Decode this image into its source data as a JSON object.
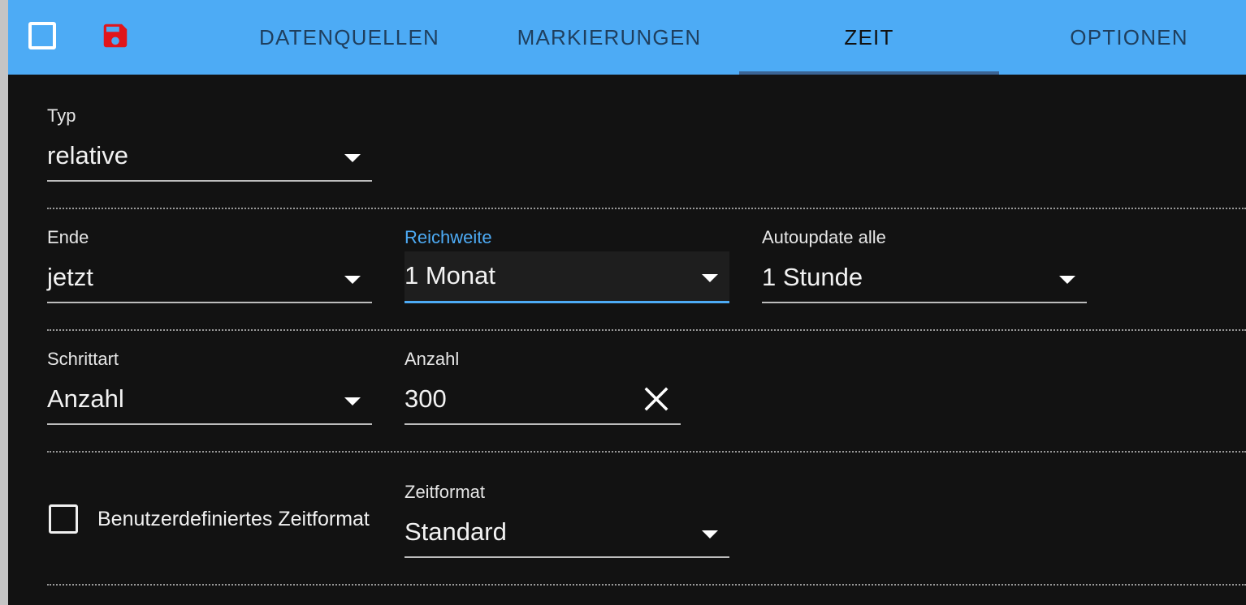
{
  "toolbar": {
    "toggle_icon": "square-outline-icon",
    "save_icon": "floppy-disk-icon",
    "save_color": "#e0161c"
  },
  "tabs": [
    {
      "label": "DATENQUELLEN"
    },
    {
      "label": "MARKIERUNGEN"
    },
    {
      "label": "ZEIT",
      "active": true
    },
    {
      "label": "OPTIONEN"
    }
  ],
  "colors": {
    "appbar": "#4dabf5",
    "background": "#121212",
    "accent": "#4dabf5"
  },
  "form": {
    "typ": {
      "label": "Typ",
      "value": "relative"
    },
    "ende": {
      "label": "Ende",
      "value": "jetzt"
    },
    "reichweite": {
      "label": "Reichweite",
      "value": "1 Monat"
    },
    "autoupdate": {
      "label": "Autoupdate alle",
      "value": "1 Stunde"
    },
    "schrittart": {
      "label": "Schrittart",
      "value": "Anzahl"
    },
    "anzahl": {
      "label": "Anzahl",
      "value": "300"
    },
    "custom_format": {
      "label": "Benutzerdefiniertes Zeitformat",
      "checked": false
    },
    "zeitformat": {
      "label": "Zeitformat",
      "value": "Standard"
    }
  }
}
